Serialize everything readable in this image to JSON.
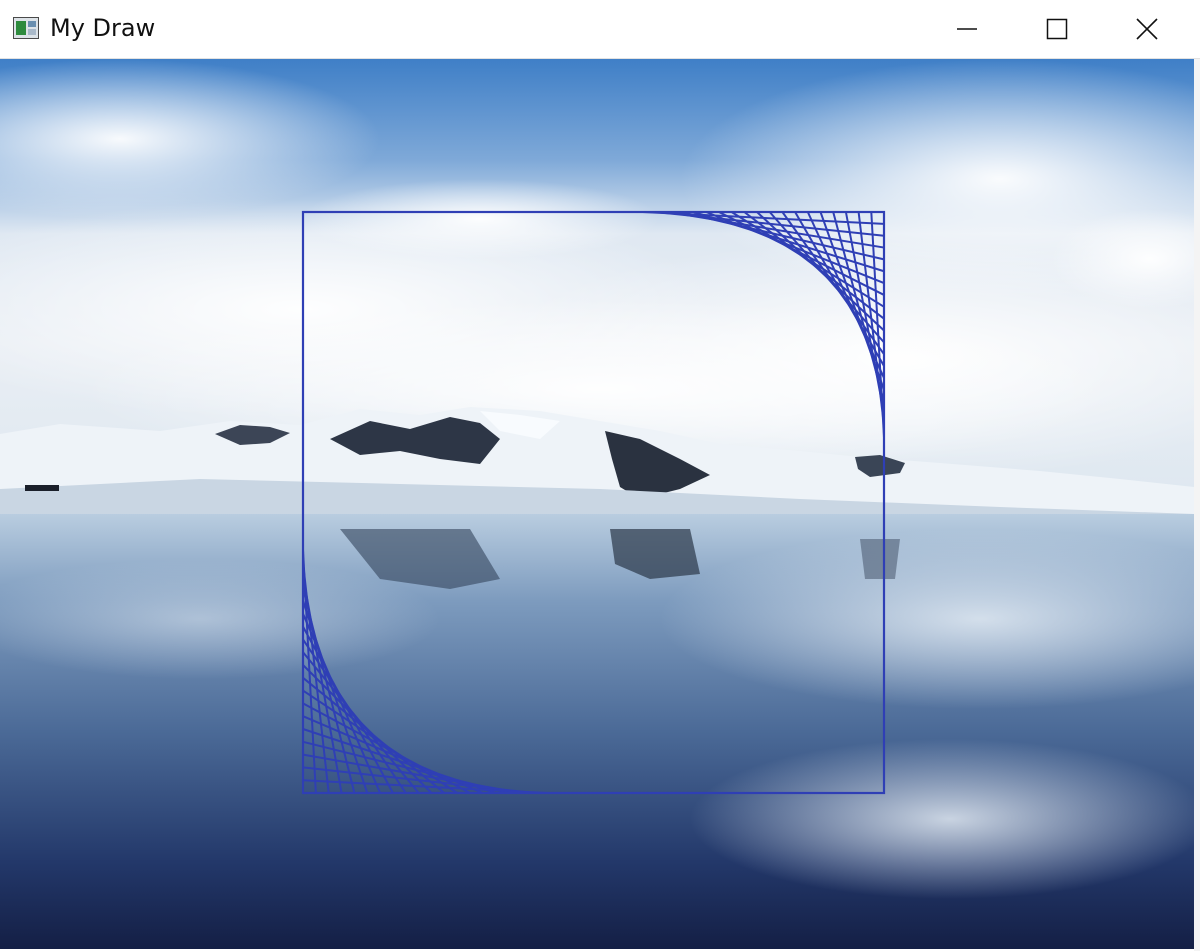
{
  "window": {
    "title": "My Draw",
    "controls": {
      "minimize_icon": "minimize-icon",
      "maximize_icon": "maximize-icon",
      "close_icon": "close-icon"
    }
  },
  "colors": {
    "stroke": "#2f3fb5",
    "sky_top": "#3a7ac6",
    "sky_cloud": "#e8eff6",
    "water_deep": "#152a55"
  }
}
